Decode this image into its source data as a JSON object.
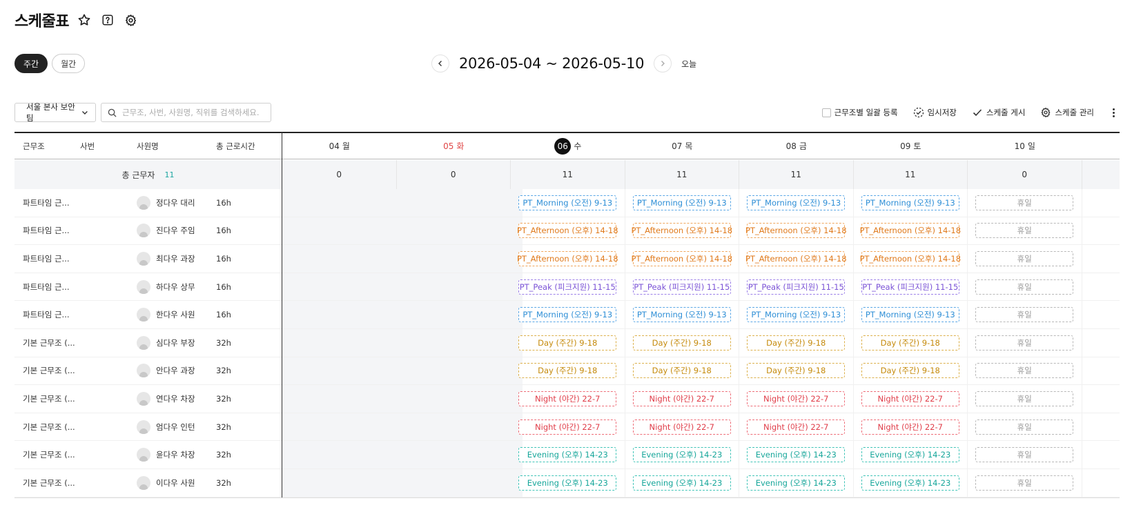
{
  "header": {
    "title": "스케줄표",
    "icons": [
      "star-icon",
      "help-icon",
      "gear-icon"
    ]
  },
  "view_toggle": {
    "weekly": "주간",
    "monthly": "월간",
    "active": "weekly"
  },
  "date_nav": {
    "range": "2026-05-04 ~ 2026-05-10",
    "today": "오늘"
  },
  "toolbar": {
    "team": "서울 본사 보안팀",
    "search_placeholder": "근무조, 사번, 사원명, 직위를 검색하세요.",
    "bulk_register": "근무조별 일괄 등록",
    "temp_save": "임시저장",
    "publish": "스케줄 게시",
    "manage": "스케줄 관리"
  },
  "columns": {
    "group": "근무조",
    "emp_no": "사번",
    "name": "사원명",
    "total_hours": "총 근로시간"
  },
  "days": [
    {
      "num": "04",
      "weekday": "월",
      "count": "0",
      "sunday": false,
      "today": false
    },
    {
      "num": "05",
      "weekday": "화",
      "count": "0",
      "sunday": true,
      "today": false
    },
    {
      "num": "06",
      "weekday": "수",
      "count": "11",
      "sunday": false,
      "today": true
    },
    {
      "num": "07",
      "weekday": "목",
      "count": "11",
      "sunday": false,
      "today": false
    },
    {
      "num": "08",
      "weekday": "금",
      "count": "11",
      "sunday": false,
      "today": false
    },
    {
      "num": "09",
      "weekday": "토",
      "count": "11",
      "sunday": false,
      "today": false
    },
    {
      "num": "10",
      "weekday": "일",
      "count": "0",
      "sunday": false,
      "today": false
    }
  ],
  "summary": {
    "label": "총 근무자",
    "count": "11"
  },
  "shift_labels": {
    "morning": "PT_Morning (오전) 9-13",
    "afternoon": "PT_Afternoon (오후) 14-18",
    "peak": "PT_Peak (피크지원) 11-15",
    "day": "Day (주간) 9-18",
    "night": "Night (야간) 22-7",
    "evening": "Evening (오후) 14-23",
    "off": "휴일"
  },
  "rows": [
    {
      "group": "파트타임 근...",
      "name": "정다우 대리",
      "hours": "16h",
      "shift": "morning"
    },
    {
      "group": "파트타임 근...",
      "name": "진다우 주임",
      "hours": "16h",
      "shift": "afternoon"
    },
    {
      "group": "파트타임 근...",
      "name": "최다우 과장",
      "hours": "16h",
      "shift": "afternoon"
    },
    {
      "group": "파트타임 근...",
      "name": "하다우 상무",
      "hours": "16h",
      "shift": "peak"
    },
    {
      "group": "파트타임 근...",
      "name": "한다우 사원",
      "hours": "16h",
      "shift": "morning"
    },
    {
      "group": "기본 근무조 (...",
      "name": "심다우 부장",
      "hours": "32h",
      "shift": "day"
    },
    {
      "group": "기본 근무조 (...",
      "name": "안다우 과장",
      "hours": "32h",
      "shift": "day"
    },
    {
      "group": "기본 근무조 (...",
      "name": "연다우 차장",
      "hours": "32h",
      "shift": "night"
    },
    {
      "group": "기본 근무조 (...",
      "name": "엄다우 인턴",
      "hours": "32h",
      "shift": "night"
    },
    {
      "group": "기본 근무조 (...",
      "name": "윤다우 차장",
      "hours": "32h",
      "shift": "evening"
    },
    {
      "group": "기본 근무조 (...",
      "name": "이다우 사원",
      "hours": "32h",
      "shift": "evening"
    }
  ]
}
